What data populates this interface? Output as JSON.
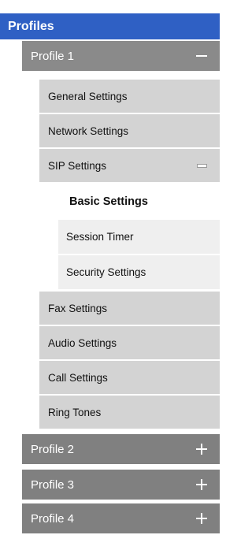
{
  "nav": {
    "title": "Profiles",
    "profile1": {
      "label": "Profile 1",
      "items": {
        "general": "General Settings",
        "network": "Network Settings",
        "sip": "SIP Settings",
        "sip_children": {
          "basic": "Basic Settings",
          "session_timer": "Session Timer",
          "security": "Security Settings"
        },
        "fax": "Fax Settings",
        "audio": "Audio Settings",
        "call": "Call Settings",
        "ring": "Ring Tones"
      }
    },
    "profile2": {
      "label": "Profile 2"
    },
    "profile3": {
      "label": "Profile 3"
    },
    "profile4": {
      "label": "Profile 4"
    }
  },
  "icons": {
    "expanded": "minus-icon",
    "collapsed": "plus-icon"
  },
  "colors": {
    "header": "#2f60c4",
    "profile": "#8a8a8a",
    "level2": "#d3d3d3",
    "level3": "#efefef",
    "active": "#ffffff"
  }
}
